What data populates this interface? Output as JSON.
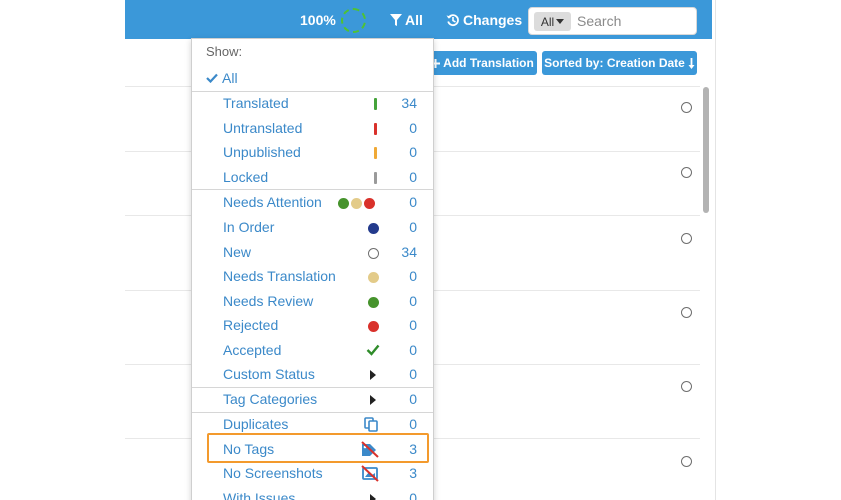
{
  "toolbar": {
    "progress_label": "100%",
    "filter_label": "All",
    "changes_label": "Changes",
    "search_scope": "All",
    "search_placeholder": "Search",
    "colors": {
      "toolbar": "#3b98d9",
      "ring": "#4fc234"
    }
  },
  "actions": {
    "add_translation": "Add Translation",
    "sort_label": "Sorted by: Creation Date"
  },
  "dropdown": {
    "header": "Show:",
    "all_label": "All",
    "groups": [
      {
        "items": [
          {
            "label": "Translated",
            "count": "34",
            "icon": "green-bar"
          },
          {
            "label": "Untranslated",
            "count": "0",
            "icon": "red-bar"
          },
          {
            "label": "Unpublished",
            "count": "0",
            "icon": "orange-bar"
          },
          {
            "label": "Locked",
            "count": "0",
            "icon": "gray-bar"
          }
        ]
      },
      {
        "items": [
          {
            "label": "Needs Attention",
            "count": "0",
            "icon": "three-dots"
          },
          {
            "label": "In Order",
            "count": "0",
            "icon": "navy-dot"
          },
          {
            "label": "New",
            "count": "34",
            "icon": "hollow-circle"
          },
          {
            "label": "Needs Translation",
            "count": "0",
            "icon": "tan-dot"
          },
          {
            "label": "Needs Review",
            "count": "0",
            "icon": "green-dot"
          },
          {
            "label": "Rejected",
            "count": "0",
            "icon": "red-dot"
          },
          {
            "label": "Accepted",
            "count": "0",
            "icon": "check-icon"
          },
          {
            "label": "Custom Status",
            "count": "0",
            "icon": "caret-right-icon"
          }
        ]
      },
      {
        "items": [
          {
            "label": "Tag Categories",
            "count": "0",
            "icon": "caret-right-icon"
          }
        ]
      },
      {
        "items": [
          {
            "label": "Duplicates",
            "count": "0",
            "icon": "duplicate-icon"
          },
          {
            "label": "No Tags",
            "count": "3",
            "icon": "no-tags-icon"
          },
          {
            "label": "No Screenshots",
            "count": "3",
            "icon": "no-screenshot-icon"
          },
          {
            "label": "With Issues",
            "count": "0",
            "icon": "caret-right-icon"
          }
        ]
      }
    ]
  }
}
